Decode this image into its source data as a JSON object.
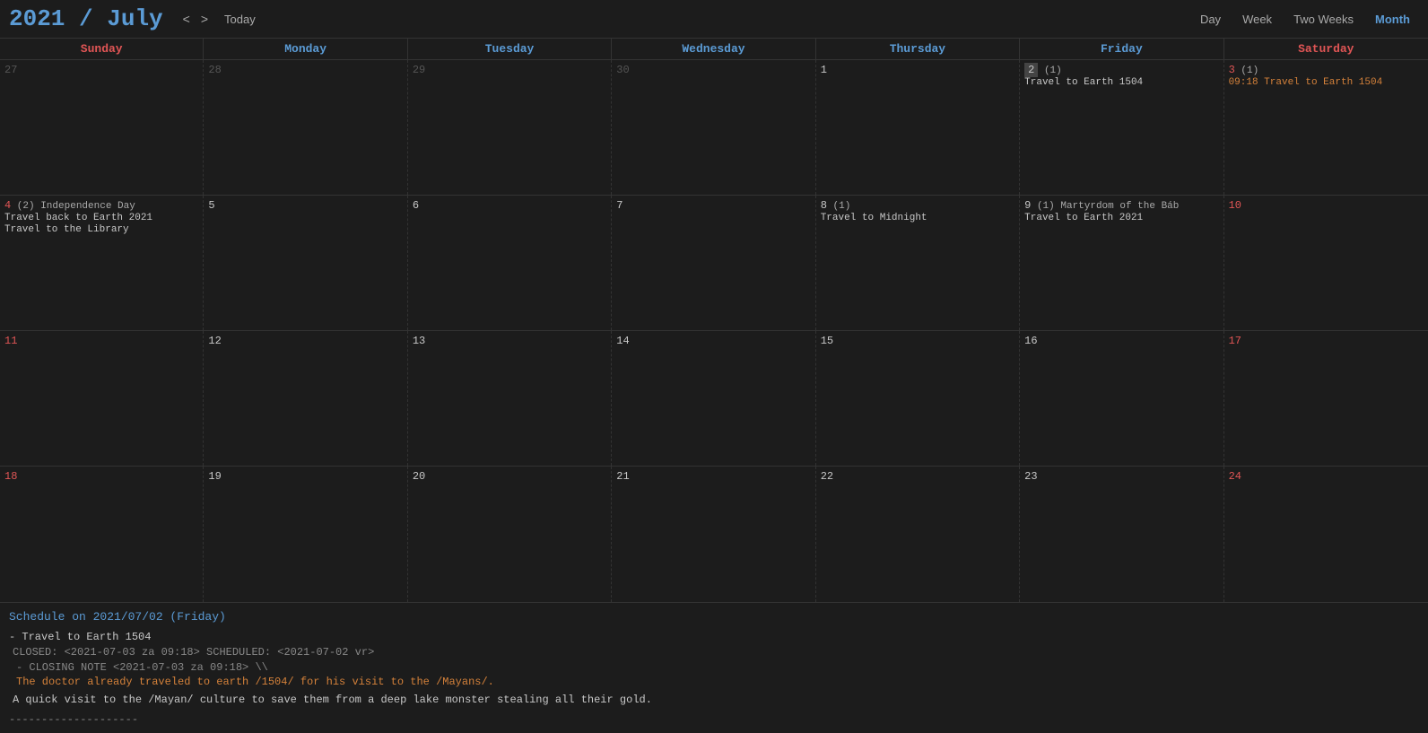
{
  "header": {
    "year": "2021",
    "slash": " / ",
    "month": "July",
    "prev_label": "<",
    "next_label": ">",
    "today_label": "Today",
    "views": [
      "Day",
      "Week",
      "Two Weeks",
      "Month"
    ],
    "active_view": "Month"
  },
  "day_headers": [
    {
      "label": "Sunday",
      "type": "sun"
    },
    {
      "label": "Monday",
      "type": "weekday"
    },
    {
      "label": "Tuesday",
      "type": "weekday"
    },
    {
      "label": "Wednesday",
      "type": "weekday"
    },
    {
      "label": "Thursday",
      "type": "weekday"
    },
    {
      "label": "Friday",
      "type": "weekday"
    },
    {
      "label": "Saturday",
      "type": "sat"
    }
  ],
  "weeks": [
    {
      "days": [
        {
          "num": "27",
          "other": true,
          "red": false,
          "selected": false,
          "holiday": null,
          "events": []
        },
        {
          "num": "28",
          "other": true,
          "red": false,
          "selected": false,
          "holiday": null,
          "events": []
        },
        {
          "num": "29",
          "other": true,
          "red": false,
          "selected": false,
          "holiday": null,
          "events": []
        },
        {
          "num": "30",
          "other": true,
          "red": false,
          "selected": false,
          "holiday": null,
          "events": []
        },
        {
          "num": "1",
          "other": false,
          "red": false,
          "selected": false,
          "holiday": null,
          "events": []
        },
        {
          "num": "2",
          "other": false,
          "red": false,
          "selected": true,
          "holiday": {
            "badge": "(1)"
          },
          "events": [
            {
              "text": "Travel to Earth 1504",
              "color": "white"
            }
          ]
        },
        {
          "num": "3",
          "other": false,
          "red": true,
          "selected": false,
          "holiday": {
            "badge": "(1)"
          },
          "events": [
            {
              "text": "09:18 Travel to Earth 1504",
              "color": "orange"
            }
          ]
        }
      ]
    },
    {
      "days": [
        {
          "num": "4",
          "other": false,
          "red": true,
          "selected": false,
          "holiday": {
            "badge": "(2) Independence Day"
          },
          "events": [
            {
              "text": "Travel back to Earth 2021",
              "color": "white"
            },
            {
              "text": "Travel to the Library",
              "color": "white"
            }
          ]
        },
        {
          "num": "5",
          "other": false,
          "red": false,
          "selected": false,
          "holiday": null,
          "events": []
        },
        {
          "num": "6",
          "other": false,
          "red": false,
          "selected": false,
          "holiday": null,
          "events": []
        },
        {
          "num": "7",
          "other": false,
          "red": false,
          "selected": false,
          "holiday": null,
          "events": []
        },
        {
          "num": "8",
          "other": false,
          "red": false,
          "selected": false,
          "holiday": {
            "badge": "(1)"
          },
          "events": [
            {
              "text": "Travel to Midnight",
              "color": "white"
            }
          ]
        },
        {
          "num": "9",
          "other": false,
          "red": false,
          "selected": false,
          "holiday": {
            "badge": "(1) Martyrdom of the Báb"
          },
          "events": [
            {
              "text": "Travel to Earth 2021",
              "color": "white"
            }
          ]
        },
        {
          "num": "10",
          "other": false,
          "red": true,
          "selected": false,
          "holiday": null,
          "events": []
        }
      ]
    },
    {
      "days": [
        {
          "num": "11",
          "other": false,
          "red": true,
          "selected": false,
          "holiday": null,
          "events": []
        },
        {
          "num": "12",
          "other": false,
          "red": false,
          "selected": false,
          "holiday": null,
          "events": []
        },
        {
          "num": "13",
          "other": false,
          "red": false,
          "selected": false,
          "holiday": null,
          "events": []
        },
        {
          "num": "14",
          "other": false,
          "red": false,
          "selected": false,
          "holiday": null,
          "events": []
        },
        {
          "num": "15",
          "other": false,
          "red": false,
          "selected": false,
          "holiday": null,
          "events": []
        },
        {
          "num": "16",
          "other": false,
          "red": false,
          "selected": false,
          "holiday": null,
          "events": []
        },
        {
          "num": "17",
          "other": false,
          "red": true,
          "selected": false,
          "holiday": null,
          "events": []
        }
      ]
    },
    {
      "days": [
        {
          "num": "18",
          "other": false,
          "red": true,
          "selected": false,
          "holiday": null,
          "events": []
        },
        {
          "num": "19",
          "other": false,
          "red": false,
          "selected": false,
          "holiday": null,
          "events": []
        },
        {
          "num": "20",
          "other": false,
          "red": false,
          "selected": false,
          "holiday": null,
          "events": []
        },
        {
          "num": "21",
          "other": false,
          "red": false,
          "selected": false,
          "holiday": null,
          "events": []
        },
        {
          "num": "22",
          "other": false,
          "red": false,
          "selected": false,
          "holiday": null,
          "events": []
        },
        {
          "num": "23",
          "other": false,
          "red": false,
          "selected": false,
          "holiday": null,
          "events": []
        },
        {
          "num": "24",
          "other": false,
          "red": true,
          "selected": false,
          "holiday": null,
          "events": []
        }
      ]
    }
  ],
  "schedule": {
    "title": "Schedule on 2021/07/02 (Friday)",
    "items": [
      {
        "name": "Travel to Earth 1504",
        "closed": "CLOSED: <2021-07-03 za 09:18> SCHEDULED: <2021-07-02 vr>",
        "closing_note_header": "- CLOSING NOTE <2021-07-03 za 09:18> \\\\",
        "closing_note_body": "    The doctor already traveled to earth /1504/ for his visit to the /Mayans/.",
        "description": "  A quick visit to the /Mayan/ culture to save them from a deep lake monster stealing all their gold."
      }
    ],
    "separator": "--------------------"
  }
}
